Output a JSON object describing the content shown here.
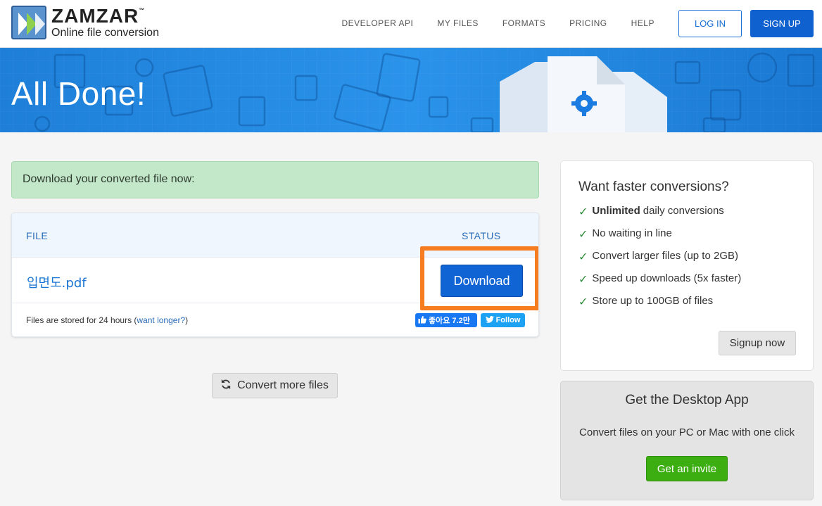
{
  "header": {
    "logo_name": "ZAMZAR",
    "logo_tm": "™",
    "logo_tagline": "Online file conversion",
    "nav": [
      "DEVELOPER API",
      "MY FILES",
      "FORMATS",
      "PRICING",
      "HELP"
    ],
    "login_label": "LOG IN",
    "signup_label": "SIGN UP"
  },
  "banner": {
    "title": "All Done!"
  },
  "alert": {
    "text": "Download your converted file now:"
  },
  "file_table": {
    "col_file": "FILE",
    "col_status": "STATUS",
    "file_name": "입면도.pdf",
    "download_label": "Download",
    "stored_text": "Files are stored for 24 hours (",
    "stored_link": "want longer?",
    "stored_close": ")",
    "fb_like": "좋아요 7.2만",
    "twitter_follow": "Follow"
  },
  "convert_more": {
    "label": "Convert more files"
  },
  "promo": {
    "title": "Want faster conversions?",
    "items": [
      {
        "bold": "Unlimited",
        "text": "daily conversions"
      },
      {
        "bold": "",
        "text": "No waiting in line"
      },
      {
        "bold": "",
        "text": "Convert larger files (up to 2GB)"
      },
      {
        "bold": "",
        "text": "Speed up downloads (5x faster)"
      },
      {
        "bold": "",
        "text": "Store up to 100GB of files"
      }
    ],
    "check": "✓",
    "signup_now": "Signup now"
  },
  "desktop_app": {
    "title": "Get the Desktop App",
    "text": "Convert files on your PC or Mac with one click",
    "invite_label": "Get an invite"
  },
  "colors": {
    "brand_blue": "#1061d0",
    "banner_blue": "#1a86e0",
    "highlight_orange": "#f57d20",
    "success_green": "#c3e8c9",
    "invite_green": "#3cae12"
  }
}
